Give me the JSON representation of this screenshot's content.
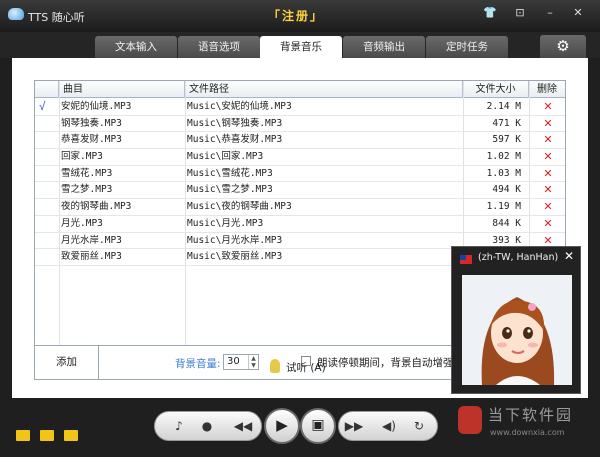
{
  "window": {
    "title": "TTS 随心听",
    "register": "「注册」",
    "controls": [
      "👕",
      "⊡",
      "–",
      "✕"
    ]
  },
  "tabs": [
    {
      "label": "文本输入",
      "active": false
    },
    {
      "label": "语音选项",
      "active": false
    },
    {
      "label": "背景音乐",
      "active": true
    },
    {
      "label": "音频输出",
      "active": false
    },
    {
      "label": "定时任务",
      "active": false
    }
  ],
  "settings_icon": "gear-icon",
  "table": {
    "headers": {
      "name": "曲目",
      "path": "文件路径",
      "size": "文件大小",
      "delete": "删除"
    },
    "rows": [
      {
        "check": "√",
        "name": "安妮的仙境.MP3",
        "path": "Music\\安妮的仙境.MP3",
        "size": "2.14 M",
        "del": "✕"
      },
      {
        "check": "",
        "name": "钢琴独奏.MP3",
        "path": "Music\\钢琴独奏.MP3",
        "size": "471 K",
        "del": "✕"
      },
      {
        "check": "",
        "name": "恭喜发财.MP3",
        "path": "Music\\恭喜发财.MP3",
        "size": "597 K",
        "del": "✕"
      },
      {
        "check": "",
        "name": "回家.MP3",
        "path": "Music\\回家.MP3",
        "size": "1.02 M",
        "del": "✕"
      },
      {
        "check": "",
        "name": "雪绒花.MP3",
        "path": "Music\\雪绒花.MP3",
        "size": "1.03 M",
        "del": "✕"
      },
      {
        "check": "",
        "name": "雪之梦.MP3",
        "path": "Music\\雪之梦.MP3",
        "size": "494 K",
        "del": "✕"
      },
      {
        "check": "",
        "name": "夜的钢琴曲.MP3",
        "path": "Music\\夜的钢琴曲.MP3",
        "size": "1.19 M",
        "del": "✕"
      },
      {
        "check": "",
        "name": "月光.MP3",
        "path": "Music\\月光.MP3",
        "size": "844 K",
        "del": "✕"
      },
      {
        "check": "",
        "name": "月光水岸.MP3",
        "path": "Music\\月光水岸.MP3",
        "size": "393 K",
        "del": "✕"
      },
      {
        "check": "",
        "name": "致爱丽丝.MP3",
        "path": "Music\\致爱丽丝.MP3",
        "size": "",
        "del": ""
      }
    ]
  },
  "footer": {
    "add_label": "添加",
    "volume_label": "背景音量:",
    "volume_value": "30",
    "auto_label": "朗读停顿期间，背景自动增强"
  },
  "preview_label": "试听 (A)",
  "popup": {
    "title": "(zh-TW, HanHan)",
    "close": "✕"
  },
  "player": {
    "rewind": "◀◀",
    "play": "▶",
    "forward": "▶▶"
  },
  "watermark": {
    "text": "当下软件园",
    "sub": "www.downxia.com"
  }
}
